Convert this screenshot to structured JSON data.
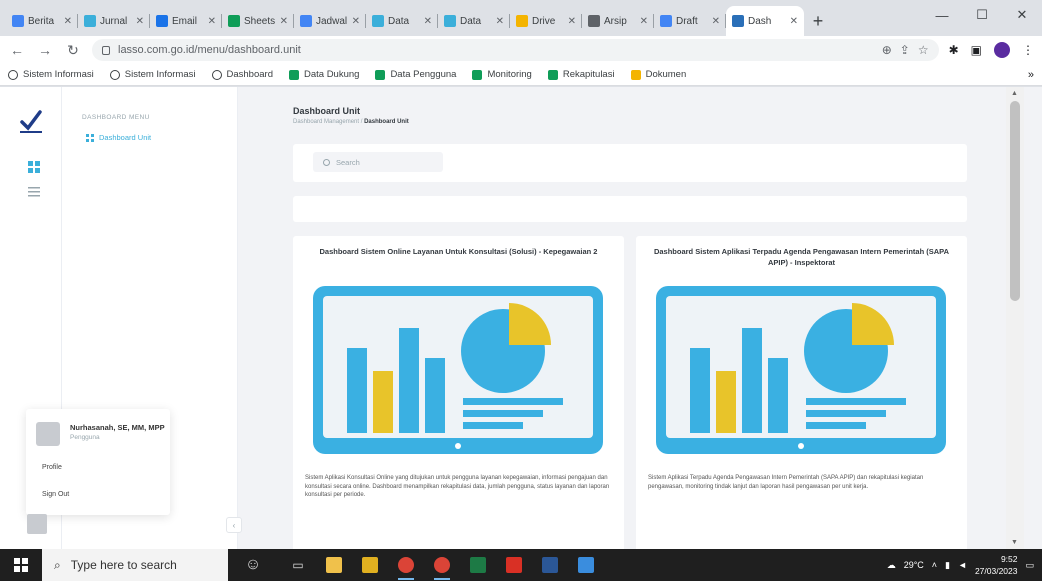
{
  "browser": {
    "tabs": [
      {
        "label": "Berita",
        "color": "#4285f4"
      },
      {
        "label": "Jurnal",
        "color": "#3bafda"
      },
      {
        "label": "Email",
        "color": "#1a73e8"
      },
      {
        "label": "Sheets",
        "color": "#0f9d58"
      },
      {
        "label": "Jadwal",
        "color": "#4285f4"
      },
      {
        "label": "Data",
        "color": "#3bafda"
      },
      {
        "label": "Data",
        "color": "#3bafda"
      },
      {
        "label": "Drive",
        "color": "#f4b400"
      },
      {
        "label": "Arsip",
        "color": "#5f6368"
      },
      {
        "label": "Draft",
        "color": "#4285f4"
      },
      {
        "label": "Dash",
        "color": "#2a6fb8"
      }
    ],
    "new_tab": "+",
    "window_controls": {
      "minimize": "—",
      "maximize": "☐",
      "close": "✕"
    },
    "url": "lasso.com.go.id/menu/dashboard.unit",
    "bookmarks": [
      {
        "label": "Sistem Informasi",
        "icon": "globe"
      },
      {
        "label": "Sistem Informasi",
        "icon": "globe"
      },
      {
        "label": "Dashboard",
        "icon": "globe"
      },
      {
        "label": "Data Dukung",
        "icon": "sheets"
      },
      {
        "label": "Data Pengguna",
        "icon": "sheets"
      },
      {
        "label": "Monitoring",
        "icon": "sheets"
      },
      {
        "label": "Rekapitulasi",
        "icon": "sheets"
      },
      {
        "label": "Dokumen",
        "icon": "drive"
      }
    ]
  },
  "sidebar": {
    "menu_heading": "DASHBOARD MENU",
    "menu_item": "Dashboard Unit",
    "user_name": "Nurhasanah, SE, MM, MPP",
    "user_role": "Pengguna",
    "profile_link": "Profile",
    "logout_link": "Sign Out",
    "collapse": "‹"
  },
  "main": {
    "title": "Dashboard Unit",
    "breadcrumb_parent": "Dashboard Management",
    "breadcrumb_current": "Dashboard Unit",
    "search_placeholder": "Search",
    "cards": [
      {
        "title": "Dashboard Sistem Online Layanan Untuk Konsultasi (Solusi) - Kepegawaian 2",
        "description": "Sistem Aplikasi Konsultasi Online yang ditujukan untuk pengguna layanan kepegawaian, informasi pengajuan dan konsultasi secara online. Dashboard menampilkan rekapitulasi data, jumlah pengguna, status layanan dan laporan konsultasi per periode."
      },
      {
        "title": "Dashboard Sistem Aplikasi Terpadu Agenda Pengawasan Intern Pemerintah (SAPA APIP) - Inspektorat",
        "description": "Sistem Aplikasi Terpadu Agenda Pengawasan Intern Pemerintah (SAPA APIP) dan rekapitulasi kegiatan pengawasan, monitoring tindak lanjut dan laporan hasil pengawasan per unit kerja."
      }
    ],
    "illustration_colors": {
      "frame": "#3ab0e2",
      "bar_blue": "#3ab0e2",
      "bar_yellow": "#e8c42a",
      "pie_blue": "#3ab0e2",
      "pie_yellow": "#e8c42a"
    }
  },
  "taskbar": {
    "search_placeholder": "Type here to search",
    "time": "9:52",
    "date": "27/03/2023",
    "weather": "29°C"
  }
}
